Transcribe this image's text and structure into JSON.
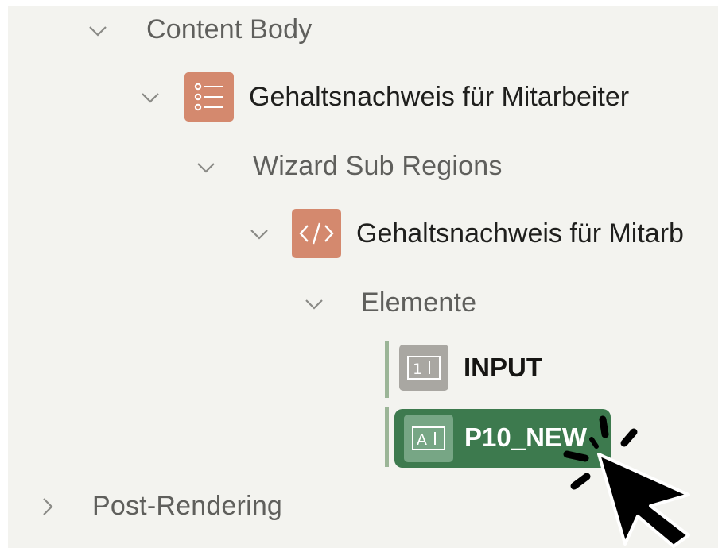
{
  "tree": {
    "content_body": {
      "label": "Content Body",
      "expanded": true
    },
    "region_form": {
      "label": "Gehaltsnachweis für Mitarbeiter",
      "icon": "form-list-icon",
      "expanded": true
    },
    "wizard_sub_regions": {
      "label": "Wizard Sub Regions",
      "expanded": true
    },
    "region_static": {
      "label": "Gehaltsnachweis für Mitarb",
      "icon": "code-icon",
      "expanded": true
    },
    "elements": {
      "label": "Elemente",
      "expanded": true
    },
    "item_input": {
      "label": "INPUT",
      "icon": "number-field-icon"
    },
    "item_p10_new": {
      "label": "P10_NEW",
      "icon": "text-field-icon",
      "selected": true
    },
    "post_rendering": {
      "label": "Post-Rendering",
      "expanded": false
    }
  },
  "colors": {
    "background": "#f3f3ef",
    "icon_orange": "#d4896e",
    "icon_gray": "#a9a7a2",
    "selection": "#3d7a4e",
    "tree_line": "#9bb597"
  }
}
